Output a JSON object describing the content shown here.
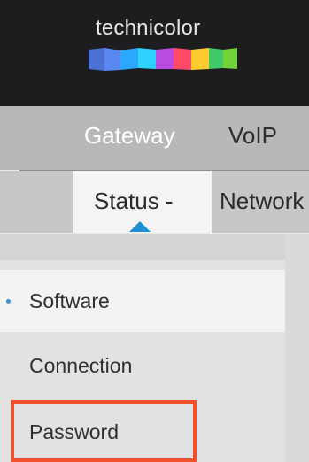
{
  "brand": {
    "name": "technicolor"
  },
  "main_nav": {
    "items": [
      {
        "label": "Gateway"
      },
      {
        "label": "VoIP"
      }
    ]
  },
  "sub_nav": {
    "tabs": [
      {
        "label": "Status -",
        "active": true
      },
      {
        "label": "Network"
      }
    ]
  },
  "sidebar": {
    "items": [
      {
        "label": "Software",
        "active": true
      },
      {
        "label": "Connection"
      },
      {
        "label": "Password",
        "highlighted": true
      }
    ]
  },
  "colors": {
    "header_background": "#1d1d1f",
    "main_nav_background": "#b8b8b8",
    "accent": "#1f8fd4",
    "highlight_box": "#f2522b"
  }
}
